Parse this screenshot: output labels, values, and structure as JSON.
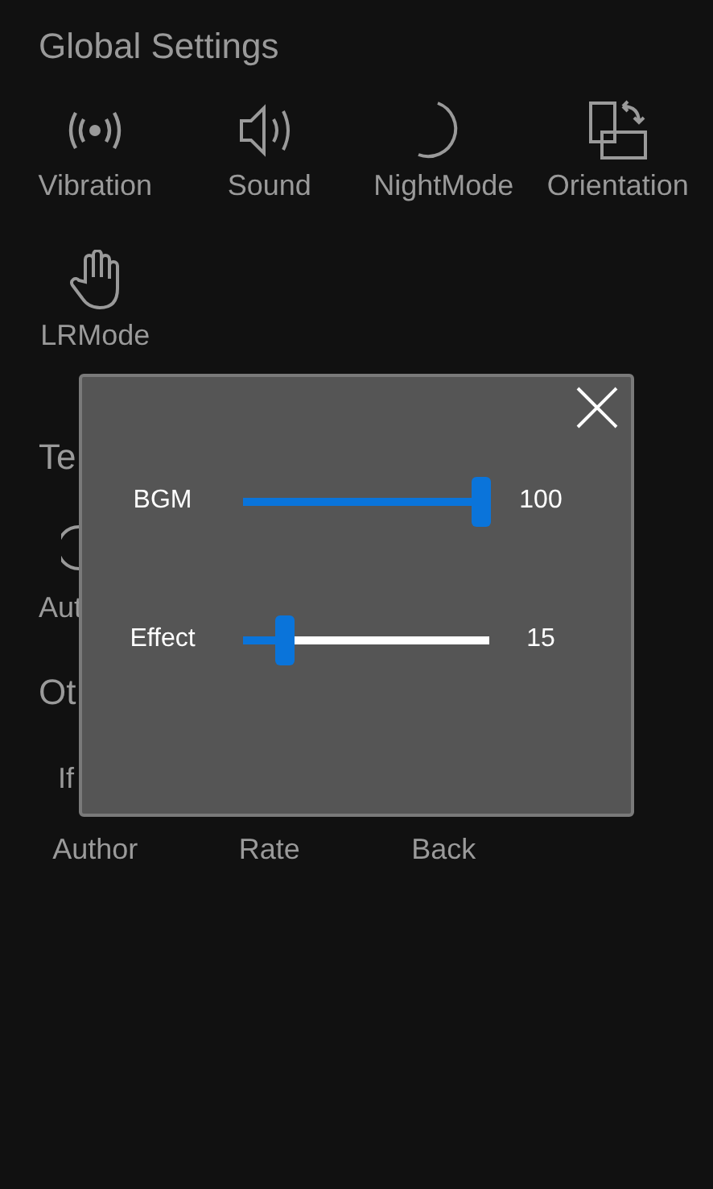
{
  "title": "Global Settings",
  "options": [
    {
      "kind": "vibration",
      "label": "Vibration"
    },
    {
      "kind": "sound",
      "label": "Sound"
    },
    {
      "kind": "night",
      "label": "NightMode"
    },
    {
      "kind": "orientation",
      "label": "Orientation"
    },
    {
      "kind": "hand",
      "label": "LRMode"
    }
  ],
  "covered": [
    {
      "kind": "heading",
      "text": "Te"
    },
    {
      "kind": "icon"
    },
    {
      "kind": "label",
      "text": "Aut"
    },
    {
      "kind": "heading",
      "text": "Ot"
    },
    {
      "kind": "label",
      "text": "If"
    }
  ],
  "links": [
    "Author",
    "Rate",
    "Back"
  ],
  "dialog": {
    "sliders": [
      {
        "label": "BGM",
        "level": 1,
        "reading": "100"
      },
      {
        "label": "Effect",
        "level": 0.15,
        "reading": "15"
      }
    ]
  }
}
